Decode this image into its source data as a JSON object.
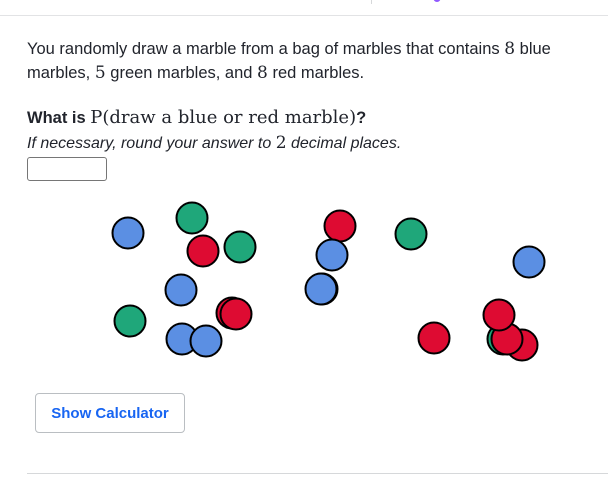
{
  "question": {
    "pre": "You randomly draw a marble from a bag of marbles that contains ",
    "blue_count": "8",
    "blue_text": " blue marbles, ",
    "green_count": "5",
    "green_text": " green marbles, and ",
    "red_count": "8",
    "red_text": " red marbles."
  },
  "prompt": {
    "lead": "What is ",
    "expression": "P(draw a blue or red marble)",
    "end": "?"
  },
  "instruction": {
    "pre": "If necessary, round your answer to ",
    "places": "2",
    "post": " decimal places."
  },
  "answer_input": {
    "value": "",
    "placeholder": ""
  },
  "calculator_button": {
    "label": "Show Calculator"
  },
  "colors": {
    "blue": "#5b8fe3",
    "green": "#1fa77a",
    "red": "#de0b32",
    "accent": "#1865f2"
  },
  "marbles": [
    {
      "color": "green"
    },
    {
      "color": "blue"
    },
    {
      "color": "red"
    },
    {
      "color": "green"
    },
    {
      "color": "blue"
    },
    {
      "color": "red"
    },
    {
      "color": "blue"
    },
    {
      "color": "green"
    },
    {
      "color": "blue"
    },
    {
      "color": "blue"
    },
    {
      "color": "green"
    },
    {
      "color": "red"
    },
    {
      "color": "red"
    },
    {
      "color": "blue"
    },
    {
      "color": "blue"
    },
    {
      "color": "red"
    },
    {
      "color": "green"
    },
    {
      "color": "red"
    },
    {
      "color": "red"
    },
    {
      "color": "red"
    },
    {
      "color": "blue"
    }
  ]
}
